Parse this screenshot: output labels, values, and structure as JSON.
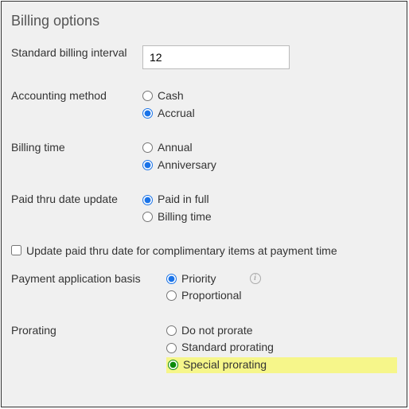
{
  "title": "Billing options",
  "stdInterval": {
    "label": "Standard billing interval",
    "value": "12"
  },
  "accounting": {
    "label": "Accounting method",
    "opts": {
      "cash": "Cash",
      "accrual": "Accrual"
    }
  },
  "billingTime": {
    "label": "Billing time",
    "opts": {
      "annual": "Annual",
      "anniversary": "Anniversary"
    }
  },
  "paidThru": {
    "label": "Paid thru date update",
    "opts": {
      "full": "Paid in full",
      "billing": "Billing time"
    }
  },
  "complimentary": {
    "label": "Update paid thru date for complimentary items at payment time"
  },
  "basis": {
    "label": "Payment application basis",
    "opts": {
      "priority": "Priority",
      "proportional": "Proportional"
    }
  },
  "prorating": {
    "label": "Prorating",
    "opts": {
      "none": "Do not prorate",
      "standard": "Standard prorating",
      "special": "Special prorating"
    }
  }
}
